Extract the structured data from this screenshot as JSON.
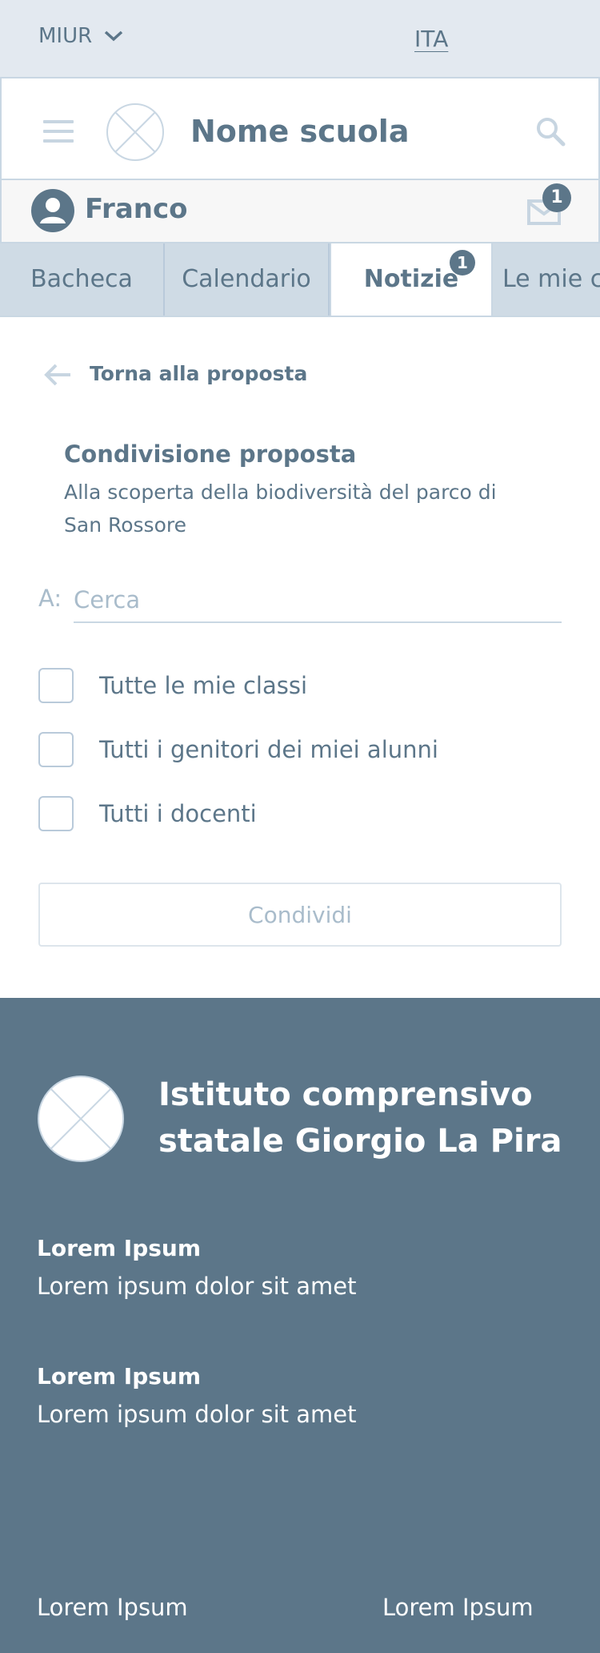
{
  "topbar": {
    "ministry": "MIUR",
    "language": "ITA"
  },
  "header": {
    "school_name": "Nome scuola"
  },
  "user": {
    "name": "Franco",
    "messages_badge": "1"
  },
  "tabs": [
    {
      "label": "Bacheca"
    },
    {
      "label": "Calendario"
    },
    {
      "label": "Notizie",
      "badge": "1"
    },
    {
      "label": "Le mie cl"
    }
  ],
  "content": {
    "back_label": "Torna alla proposta",
    "proposal_title": "Condivisione proposta",
    "proposal_description": "Alla scoperta della biodiversità del parco di San Rossore",
    "to_label": "A:",
    "search_placeholder": "Cerca",
    "options": [
      {
        "label": "Tutte le mie classi",
        "checked": false
      },
      {
        "label": "Tutti i genitori dei miei alunni",
        "checked": false
      },
      {
        "label": "Tutti i docenti",
        "checked": false
      }
    ],
    "share_label": "Condividi"
  },
  "footer": {
    "title": "Istituto comprensivo statale Giorgio La Pira",
    "blocks": [
      {
        "heading": "Lorem Ipsum",
        "text": "Lorem ipsum dolor sit amet"
      },
      {
        "heading": "Lorem Ipsum",
        "text": "Lorem ipsum dolor sit amet"
      }
    ],
    "links": [
      "Lorem Ipsum",
      "Lorem Ipsum"
    ]
  },
  "colors": {
    "primary": "#5c7689",
    "border": "#c9d7e3",
    "tab_background": "#cfdbe5",
    "topbar_background": "#e3e9f0",
    "muted": "#a9bccb"
  }
}
